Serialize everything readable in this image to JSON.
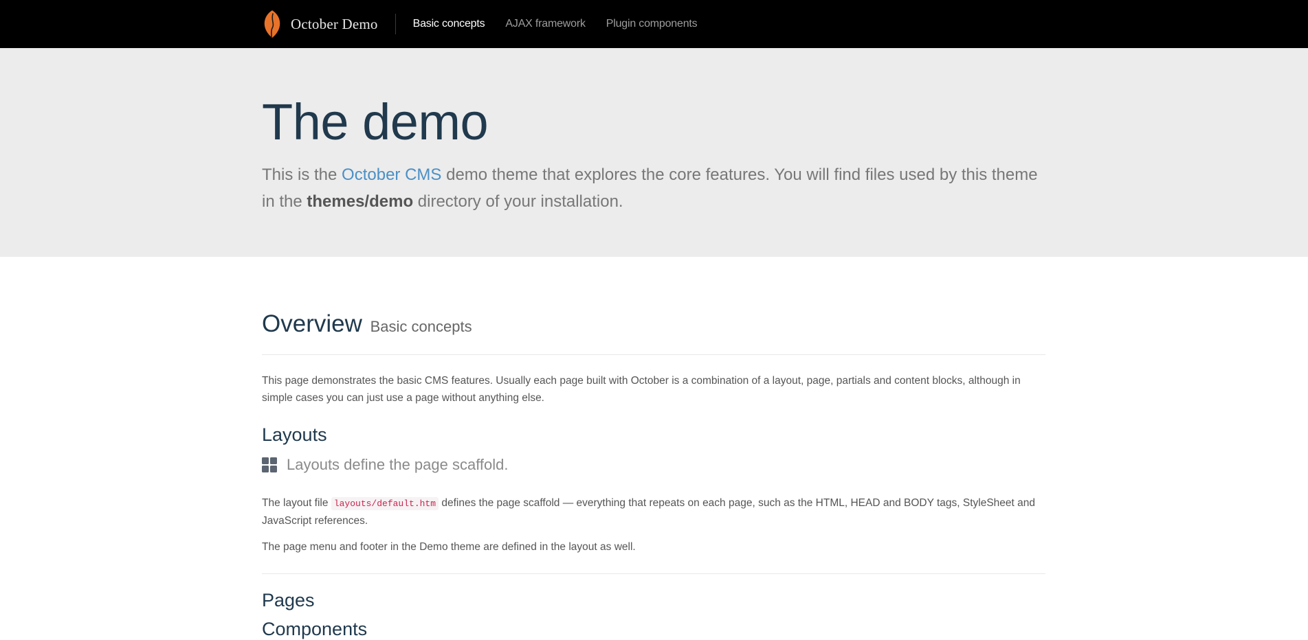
{
  "navbar": {
    "brand": "October Demo",
    "links": [
      {
        "label": "Basic concepts",
        "active": true
      },
      {
        "label": "AJAX framework",
        "active": false
      },
      {
        "label": "Plugin components",
        "active": false
      }
    ]
  },
  "hero": {
    "title": "The demo",
    "lead_before": "This is the ",
    "lead_link": "October CMS",
    "lead_middle": " demo theme that explores the core features. You will find files used by this theme in the ",
    "lead_bold": "themes/demo",
    "lead_after": " directory of your installation."
  },
  "overview": {
    "title": "Overview",
    "subtitle": "Basic concepts",
    "intro": "This page demonstrates the basic CMS features. Usually each page built with October is a combination of a layout, page, partials and content blocks, although in simple cases you can just use a page without anything else."
  },
  "layouts": {
    "heading": "Layouts",
    "lead": "Layouts define the page scaffold.",
    "icon": "th-large-icon",
    "para1_before": "The layout file ",
    "para1_code": "layouts/default.htm",
    "para1_after": " defines the page scaffold — everything that repeats on each page, such as the HTML, HEAD and BODY tags, StyleSheet and JavaScript references.",
    "para2": "The page menu and footer in the Demo theme are defined in the layout as well."
  },
  "pages": {
    "heading": "Pages",
    "next_heading": "Components"
  },
  "colors": {
    "navbar_bg": "#000000",
    "hero_bg": "#ececec",
    "heading": "#20394d",
    "link": "#4a90c6",
    "logo": "#e8732a"
  }
}
